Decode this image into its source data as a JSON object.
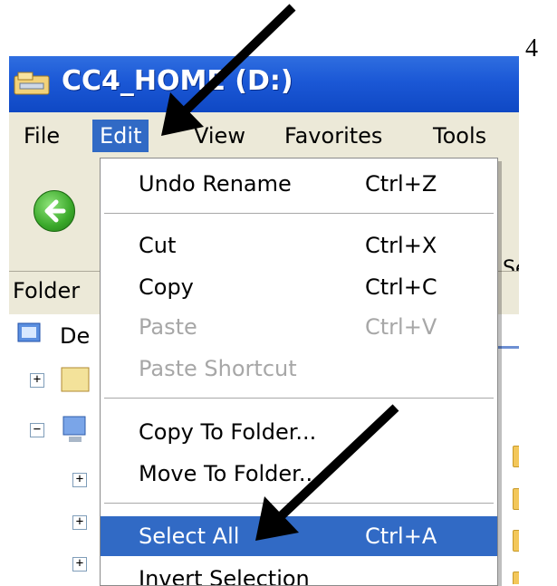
{
  "page_number": "4",
  "window": {
    "title": "CC4_HOME (D:)",
    "accent_color": "#1b58d6",
    "icon": "drive-icon"
  },
  "menubar": {
    "items": [
      {
        "label": "File"
      },
      {
        "label": "Edit"
      },
      {
        "label": "View"
      },
      {
        "label": "Favorites"
      },
      {
        "label": "Tools"
      }
    ],
    "active_index": 1
  },
  "toolbar": {
    "back_icon": "back-arrow-icon",
    "partial_text": "Se"
  },
  "folders_bar": {
    "label": "Folder"
  },
  "tree": {
    "root_label": "De"
  },
  "edit_menu": {
    "items": [
      {
        "label": "Undo Rename",
        "shortcut": "Ctrl+Z",
        "enabled": true
      },
      {
        "separator": true
      },
      {
        "label": "Cut",
        "shortcut": "Ctrl+X",
        "enabled": true
      },
      {
        "label": "Copy",
        "shortcut": "Ctrl+C",
        "enabled": true
      },
      {
        "label": "Paste",
        "shortcut": "Ctrl+V",
        "enabled": false
      },
      {
        "label": "Paste Shortcut",
        "shortcut": "",
        "enabled": false
      },
      {
        "separator": true
      },
      {
        "label": "Copy To Folder...",
        "shortcut": "",
        "enabled": true
      },
      {
        "label": "Move To Folder...",
        "shortcut": "",
        "enabled": true
      },
      {
        "separator": true
      },
      {
        "label": "Select All",
        "shortcut": "Ctrl+A",
        "enabled": true,
        "selected": true
      },
      {
        "label": "Invert Selection",
        "shortcut": "",
        "enabled": true
      }
    ],
    "highlight_color": "#316ac5"
  },
  "annotations": [
    {
      "icon": "arrow-icon",
      "points_to": "Edit menu"
    },
    {
      "icon": "arrow-icon",
      "points_to": "Select All"
    }
  ]
}
